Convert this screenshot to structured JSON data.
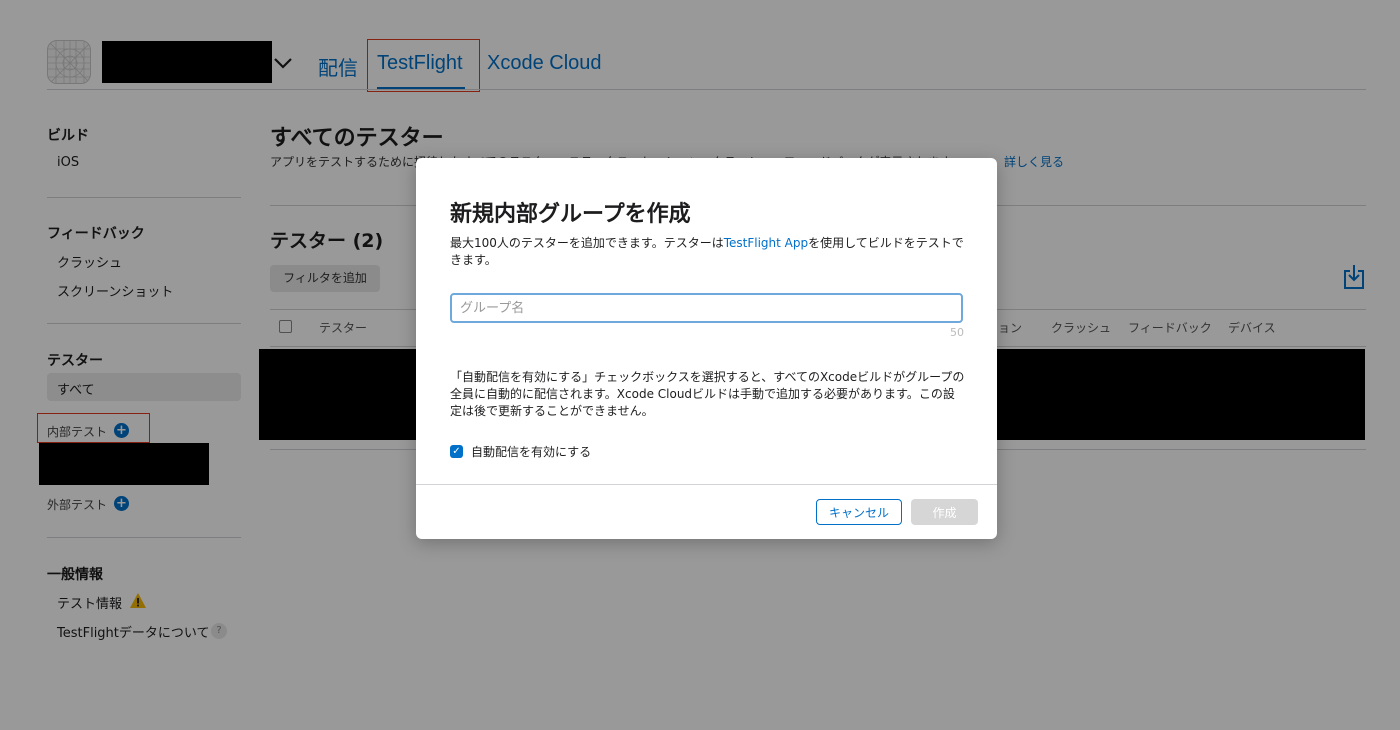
{
  "header": {
    "tabs": [
      {
        "label": "配信"
      },
      {
        "label": "TestFlight"
      },
      {
        "label": "Xcode Cloud"
      }
    ],
    "accent_color": "#0070c9",
    "highlight_color": "#e0391f"
  },
  "sidebar": {
    "builds": {
      "heading": "ビルド",
      "items": [
        "iOS"
      ]
    },
    "feedback": {
      "heading": "フィードバック",
      "items": [
        "クラッシュ",
        "スクリーンショット"
      ]
    },
    "testers": {
      "heading": "テスター",
      "items": [
        "すべて"
      ],
      "internal_label": "内部テスト",
      "external_label": "外部テスト"
    },
    "general": {
      "heading": "一般情報",
      "items": [
        "テスト情報",
        "TestFlightデータについて"
      ]
    }
  },
  "main": {
    "title": "すべてのテスター",
    "description": "アプリをテストするために招待したすべてのテスター、ステータス、セッション、クラッシュ、フィードバックが表示されます。",
    "learn_more": "詳しく見る",
    "testers_heading": "テスター (2)",
    "filter_button": "フィルタを追加",
    "columns": [
      "テスター",
      "ョン",
      "クラッシュ",
      "フィードバック",
      "デバイス"
    ]
  },
  "modal": {
    "title": "新規内部グループを作成",
    "desc_prefix": "最大100人のテスターを追加できます。テスターは",
    "desc_link": "TestFlight App",
    "desc_suffix": "を使用してビルドをテストできます。",
    "input_placeholder": "グループ名",
    "input_value": "",
    "char_limit": "50",
    "info": "「自動配信を有効にする」チェックボックスを選択すると、すべてのXcodeビルドがグループの全員に自動的に配信されます。Xcode Cloudビルドは手動で追加する必要があります。この設定は後で更新することができません。",
    "auto_distribution_checked": true,
    "auto_distribution_label": "自動配信を有効にする",
    "cancel_label": "キャンセル",
    "create_label": "作成"
  }
}
